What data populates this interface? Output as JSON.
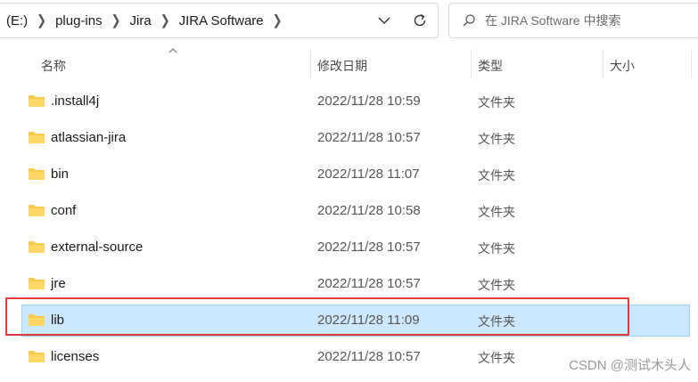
{
  "address_bar": {
    "breadcrumbs": [
      "(E:)",
      "plug-ins",
      "Jira",
      "JIRA Software"
    ]
  },
  "search": {
    "placeholder": "在 JIRA Software 中搜索"
  },
  "columns": {
    "name": "名称",
    "date": "修改日期",
    "type": "类型",
    "size": "大小"
  },
  "rows": [
    {
      "name": ".install4j",
      "date": "2022/11/28 10:59",
      "type": "文件夹"
    },
    {
      "name": "atlassian-jira",
      "date": "2022/11/28 10:57",
      "type": "文件夹"
    },
    {
      "name": "bin",
      "date": "2022/11/28 11:07",
      "type": "文件夹"
    },
    {
      "name": "conf",
      "date": "2022/11/28 10:58",
      "type": "文件夹"
    },
    {
      "name": "external-source",
      "date": "2022/11/28 10:57",
      "type": "文件夹"
    },
    {
      "name": "jre",
      "date": "2022/11/28 10:57",
      "type": "文件夹"
    },
    {
      "name": "lib",
      "date": "2022/11/28 11:09",
      "type": "文件夹",
      "selected": true
    },
    {
      "name": "licenses",
      "date": "2022/11/28 10:57",
      "type": "文件夹"
    }
  ],
  "colors": {
    "selected_bg": "#cce8ff",
    "highlight_border": "#e0383e",
    "folder": "#f8c94b"
  },
  "watermark": "CSDN @测试木头人"
}
